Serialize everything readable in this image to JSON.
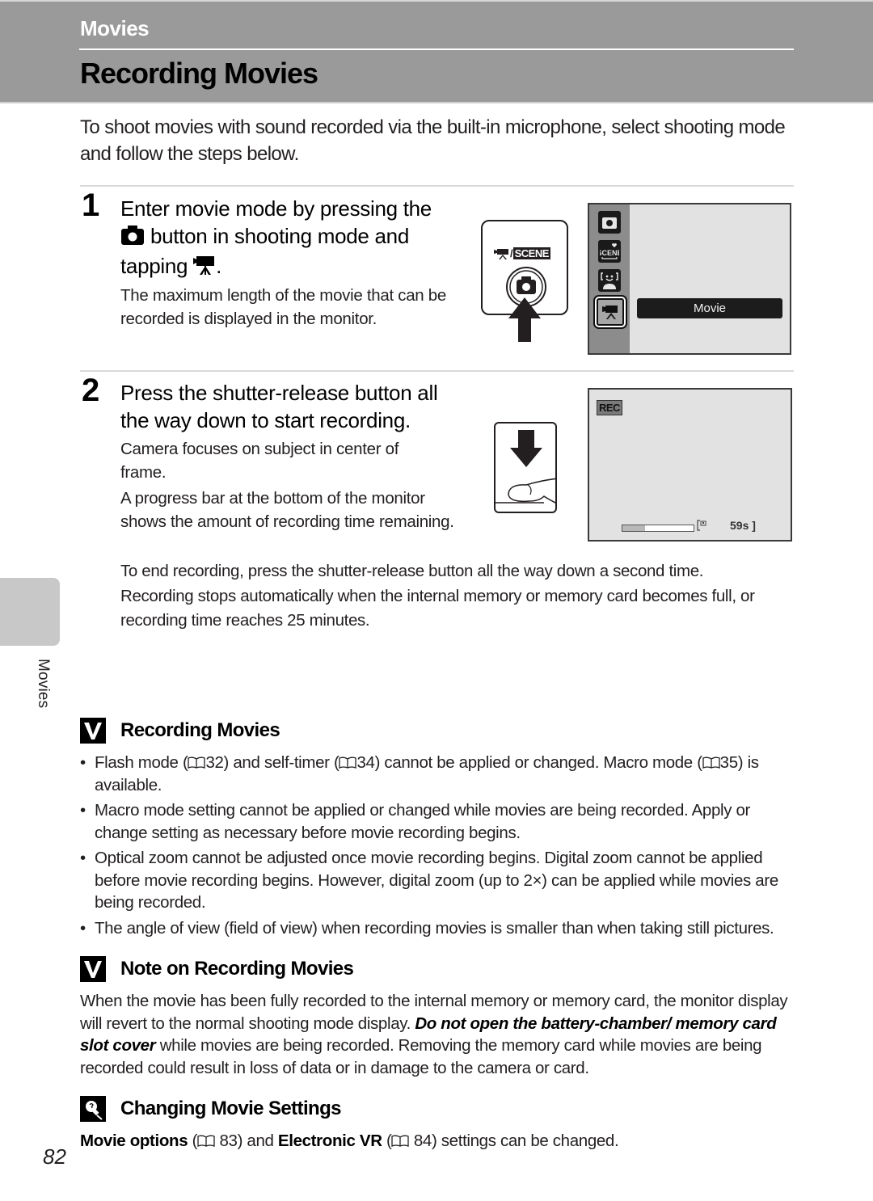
{
  "header": {
    "section": "Movies",
    "title": "Recording Movies"
  },
  "intro": "To shoot movies with sound recorded via the built-in microphone, select shooting mode and follow the steps below.",
  "steps": [
    {
      "number": "1",
      "heading_part1": "Enter movie mode by pressing the",
      "heading_icon": "camera-icon",
      "heading_part2": "button in shooting mode and",
      "heading_part3": "tapping",
      "heading_icon2": "movie-camera-icon",
      "heading_end": ".",
      "body": [
        "The maximum length of the movie that can be recorded is displayed in the monitor."
      ],
      "button_diagram": {
        "mode_label_prefix": "/",
        "scene_label": "SCENE",
        "icon": "camera-button-icon",
        "arrow": "arrow-up-icon"
      },
      "monitor": {
        "modes": [
          "camera-mode-icon",
          "scene-mode-icon",
          "smart-portrait-icon",
          "movie-mode-icon"
        ],
        "selected_mode": "movie-mode-icon",
        "selected_label": "Movie"
      }
    },
    {
      "number": "2",
      "heading": "Press the shutter-release button all the way down to start recording.",
      "body": [
        "Camera focuses on subject in center of frame.",
        "A progress bar at the bottom of the monitor shows the amount of recording time remaining."
      ],
      "shutter_diagram": {
        "icon": "press-shutter-icon"
      },
      "monitor": {
        "rec_label": "REC",
        "progress_fraction": 0.32,
        "memory_icon": "internal-memory-icon",
        "time_remaining": "59s"
      },
      "extra": [
        "To end recording, press the shutter-release button all the way down a second time.",
        "Recording stops automatically when the internal memory or memory card becomes full, or recording time reaches 25 minutes."
      ]
    }
  ],
  "side_tab": {
    "label": "Movies"
  },
  "notes": [
    {
      "icon": "check-icon",
      "title": "Recording Movies",
      "bullets": [
        {
          "parts": [
            "Flash mode (",
            "32) and self-timer (",
            "34) cannot be applied or changed. Macro mode (",
            "35) is available."
          ]
        },
        {
          "parts": [
            "Macro mode setting cannot be applied or changed while movies are being recorded. Apply or change setting as necessary before movie recording begins."
          ]
        },
        {
          "parts": [
            "Optical zoom cannot be adjusted once movie recording begins. Digital zoom cannot be applied before movie recording begins. However, digital zoom (up to 2×) can be applied while movies are being recorded."
          ]
        },
        {
          "parts": [
            "The angle of view (field of view) when recording movies is smaller than when taking still pictures."
          ]
        }
      ]
    },
    {
      "icon": "check-icon",
      "title": "Note on Recording Movies",
      "body_before": "When the movie has been fully recorded to the internal memory or memory card, the monitor display will revert to the normal shooting mode display. ",
      "body_bold": "Do not open the battery-chamber/ memory card slot cover",
      "body_after": " while movies are being recorded. Removing the memory card while movies are being recorded could result in loss of data or in damage to the camera or card."
    },
    {
      "icon": "tip-bulb-icon",
      "title": "Changing Movie Settings",
      "bold1": "Movie options",
      "ref1": "83",
      "mid": " and ",
      "bold2": "Electronic VR",
      "ref2": "84",
      "end": " settings can be changed."
    }
  ],
  "page_number": "82"
}
